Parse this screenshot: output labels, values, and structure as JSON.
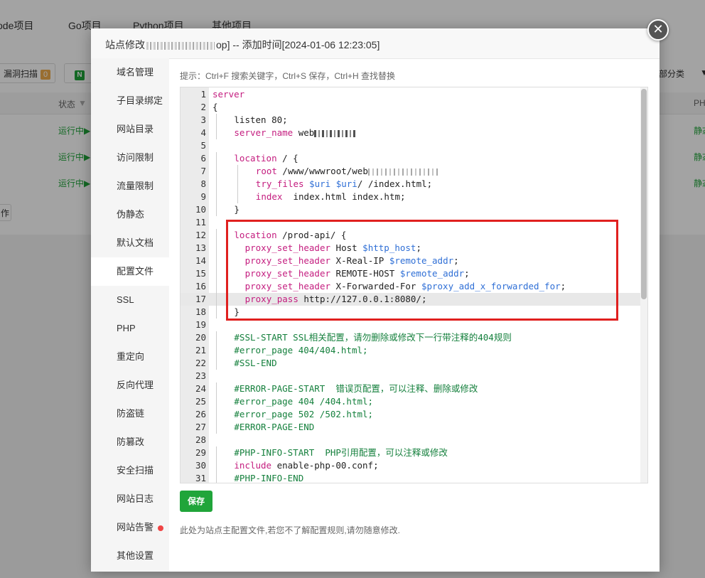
{
  "background": {
    "tabs": [
      "ode项目",
      "Go项目",
      "Python项目",
      "其他项目"
    ],
    "scan_button": "漏洞扫描",
    "scan_count": "0",
    "nginx_badge": "N",
    "category_button": "部分类",
    "column_status": "状态",
    "column_php": "PH",
    "row_status": "运行中▶",
    "row_static": "静态",
    "partial_button": "作"
  },
  "modal": {
    "title_prefix": "站点修改",
    "title_suffix": "op] -- 添加时间[2024-01-06 12:23:05]",
    "close_label": "✕"
  },
  "menu": {
    "items": [
      {
        "label": "域名管理"
      },
      {
        "label": "子目录绑定"
      },
      {
        "label": "网站目录"
      },
      {
        "label": "访问限制"
      },
      {
        "label": "流量限制"
      },
      {
        "label": "伪静态"
      },
      {
        "label": "默认文档"
      },
      {
        "label": "配置文件",
        "active": true
      },
      {
        "label": "SSL"
      },
      {
        "label": "PHP"
      },
      {
        "label": "重定向"
      },
      {
        "label": "反向代理"
      },
      {
        "label": "防盗链"
      },
      {
        "label": "防篡改"
      },
      {
        "label": "安全扫描"
      },
      {
        "label": "网站日志"
      },
      {
        "label": "网站告警",
        "alert": true
      },
      {
        "label": "其他设置"
      }
    ]
  },
  "editor": {
    "tip": "提示：Ctrl+F 搜索关键字，Ctrl+S 保存，Ctrl+H 查找替换",
    "highlighted_line": 17,
    "lines": [
      {
        "n": "1",
        "indent": 0,
        "parts": [
          {
            "t": "server",
            "c": "kw"
          }
        ]
      },
      {
        "n": "2",
        "indent": 0,
        "parts": [
          {
            "t": "{"
          }
        ]
      },
      {
        "n": "3",
        "indent": 1,
        "parts": [
          {
            "t": "listen 80;"
          }
        ]
      },
      {
        "n": "4",
        "indent": 1,
        "parts": [
          {
            "t": "server_name",
            "c": "kw"
          },
          {
            "t": " web"
          },
          {
            "redact": "redact2"
          }
        ]
      },
      {
        "n": "5",
        "indent": 0,
        "parts": []
      },
      {
        "n": "6",
        "indent": 1,
        "parts": [
          {
            "t": "location",
            "c": "kw"
          },
          {
            "t": " / {"
          }
        ]
      },
      {
        "n": "7",
        "indent": 2,
        "parts": [
          {
            "t": "root",
            "c": "kw"
          },
          {
            "t": " /www/wwwroot/web"
          },
          {
            "redact": "redact3"
          }
        ]
      },
      {
        "n": "8",
        "indent": 2,
        "parts": [
          {
            "t": "try_files",
            "c": "kw"
          },
          {
            "t": " "
          },
          {
            "t": "$uri",
            "c": "var"
          },
          {
            "t": " "
          },
          {
            "t": "$uri",
            "c": "var"
          },
          {
            "t": "/ /index.html;"
          }
        ]
      },
      {
        "n": "9",
        "indent": 2,
        "parts": [
          {
            "t": "index",
            "c": "kw"
          },
          {
            "t": "  index.html index.htm;"
          }
        ]
      },
      {
        "n": "10",
        "indent": 1,
        "parts": [
          {
            "t": "}"
          }
        ]
      },
      {
        "n": "11",
        "indent": 0,
        "parts": []
      },
      {
        "n": "12",
        "indent": 1,
        "parts": [
          {
            "t": "location",
            "c": "kw"
          },
          {
            "t": " /prod-api/ {"
          }
        ]
      },
      {
        "n": "13",
        "indent": 1.5,
        "parts": [
          {
            "t": "proxy_set_header",
            "c": "kw"
          },
          {
            "t": " Host "
          },
          {
            "t": "$http_host",
            "c": "var"
          },
          {
            "t": ";"
          }
        ]
      },
      {
        "n": "14",
        "indent": 1.5,
        "parts": [
          {
            "t": "proxy_set_header",
            "c": "kw"
          },
          {
            "t": " X-Real-IP "
          },
          {
            "t": "$remote_addr",
            "c": "var"
          },
          {
            "t": ";"
          }
        ]
      },
      {
        "n": "15",
        "indent": 1.5,
        "parts": [
          {
            "t": "proxy_set_header",
            "c": "kw"
          },
          {
            "t": " REMOTE-HOST "
          },
          {
            "t": "$remote_addr",
            "c": "var"
          },
          {
            "t": ";"
          }
        ]
      },
      {
        "n": "16",
        "indent": 1.5,
        "parts": [
          {
            "t": "proxy_set_header",
            "c": "kw"
          },
          {
            "t": " X-Forwarded-For "
          },
          {
            "t": "$proxy_add_x_forwarded_for",
            "c": "var"
          },
          {
            "t": ";"
          }
        ]
      },
      {
        "n": "17",
        "indent": 1.5,
        "parts": [
          {
            "t": "proxy_pass",
            "c": "kw"
          },
          {
            "t": " http://127.0.0.1:8080/;"
          }
        ]
      },
      {
        "n": "18",
        "indent": 1,
        "parts": [
          {
            "t": "}"
          }
        ]
      },
      {
        "n": "19",
        "indent": 0,
        "parts": []
      },
      {
        "n": "20",
        "indent": 1,
        "parts": [
          {
            "t": "#SSL-START SSL相关配置，请勿删除或修改下一行带注释的404规则",
            "c": "cmt"
          }
        ]
      },
      {
        "n": "21",
        "indent": 1,
        "parts": [
          {
            "t": "#error_page 404/404.html;",
            "c": "cmt"
          }
        ]
      },
      {
        "n": "22",
        "indent": 1,
        "parts": [
          {
            "t": "#SSL-END",
            "c": "cmt"
          }
        ]
      },
      {
        "n": "23",
        "indent": 0,
        "parts": []
      },
      {
        "n": "24",
        "indent": 1,
        "parts": [
          {
            "t": "#ERROR-PAGE-START  错误页配置，可以注释、删除或修改",
            "c": "cmt"
          }
        ]
      },
      {
        "n": "25",
        "indent": 1,
        "parts": [
          {
            "t": "#error_page 404 /404.html;",
            "c": "cmt"
          }
        ]
      },
      {
        "n": "26",
        "indent": 1,
        "parts": [
          {
            "t": "#error_page 502 /502.html;",
            "c": "cmt"
          }
        ]
      },
      {
        "n": "27",
        "indent": 1,
        "parts": [
          {
            "t": "#ERROR-PAGE-END",
            "c": "cmt"
          }
        ]
      },
      {
        "n": "28",
        "indent": 0,
        "parts": []
      },
      {
        "n": "29",
        "indent": 1,
        "parts": [
          {
            "t": "#PHP-INFO-START  PHP引用配置，可以注释或修改",
            "c": "cmt"
          }
        ]
      },
      {
        "n": "30",
        "indent": 1,
        "parts": [
          {
            "t": "include",
            "c": "kw"
          },
          {
            "t": " enable-php-00.conf;"
          }
        ]
      },
      {
        "n": "31",
        "indent": 1,
        "parts": [
          {
            "t": "#PHP-INFO-END",
            "c": "cmt"
          }
        ]
      }
    ]
  },
  "save_label": "保存",
  "note": "此处为站点主配置文件,若您不了解配置规则,请勿随意修改.",
  "colors": {
    "accent": "#20a53a",
    "highlight_box": "#e0201f",
    "keyword": "#c41d7f",
    "variable": "#2f6fd6",
    "comment": "#15803d"
  }
}
